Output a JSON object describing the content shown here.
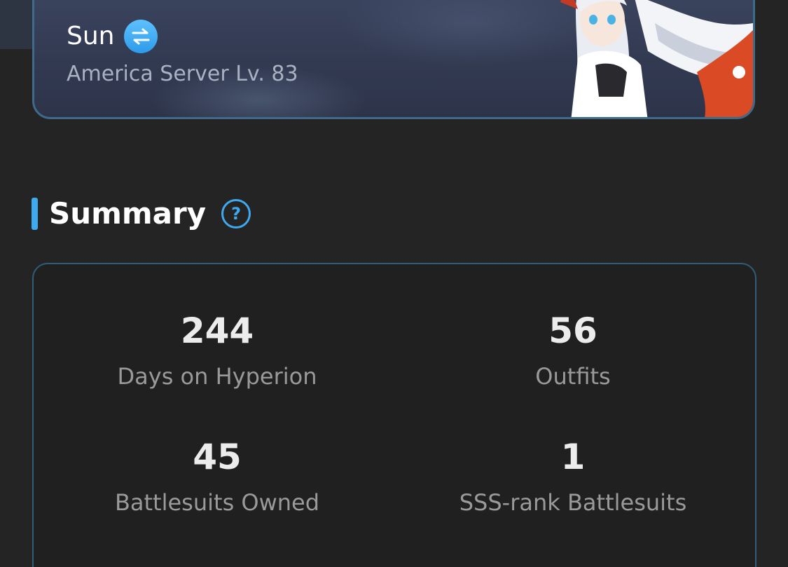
{
  "profile": {
    "name": "Sun",
    "server_level": "America Server Lv. 83",
    "switch_icon": "swap-arrows-icon",
    "character_art": "character-portrait"
  },
  "summary": {
    "title": "Summary",
    "help_icon": "question-circle-icon",
    "stats": [
      {
        "value": "244",
        "label": "Days on Hyperion"
      },
      {
        "value": "56",
        "label": "Outfits"
      },
      {
        "value": "45",
        "label": "Battlesuits Owned"
      },
      {
        "value": "1",
        "label": "SSS-rank Battlesuits"
      }
    ]
  },
  "colors": {
    "background": "#242424",
    "accent": "#3fa9ef",
    "card_border": "#2f5e78",
    "profile_bg": "#323a52",
    "label_text": "#9a9a9a"
  }
}
